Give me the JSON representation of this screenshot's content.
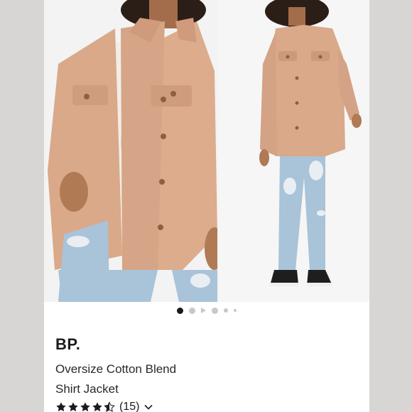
{
  "product": {
    "brand": "BP.",
    "title_line1": "Oversize Cotton Blend",
    "title_line2": "Shirt Jacket",
    "review_count": "(15)",
    "rating": 4.5,
    "rating_max": 5
  },
  "gallery": {
    "image_count": 6,
    "active_index": 0,
    "images": [
      "front-closeup-photo",
      "full-body-photo"
    ]
  },
  "colors": {
    "jacket": "#d9a98a",
    "denim": "#a9c3d8",
    "star": "#1c1c1c",
    "active_dot": "#1a1a1a",
    "inactive_dot": "#c8c8c8"
  }
}
